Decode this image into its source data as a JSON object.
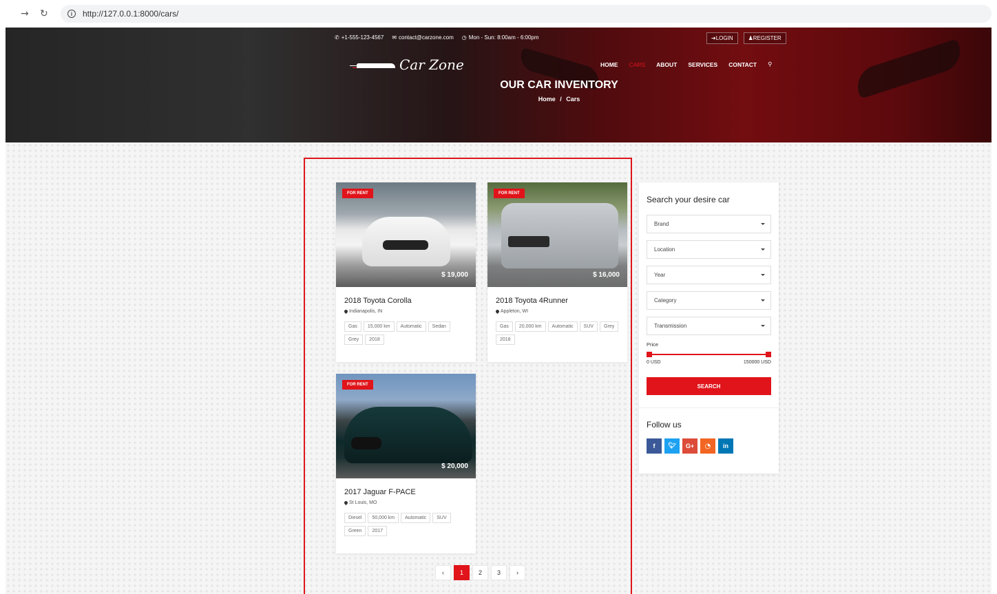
{
  "browser": {
    "url": "http://127.0.0.1:8000/cars/"
  },
  "topbar": {
    "phone": "+1-555-123-4567",
    "email": "contact@carzone.com",
    "hours": "Mon - Sun: 8:00am - 6:00pm",
    "login": "LOGIN",
    "register": "REGISTER"
  },
  "logo": {
    "text": "Car Zone"
  },
  "menu": {
    "home": "HOME",
    "cars": "CARS",
    "about": "ABOUT",
    "services": "SERVICES",
    "contact": "CONTACT"
  },
  "hero": {
    "title": "OUR CAR INVENTORY",
    "crumb_home": "Home",
    "crumb_sep": "/",
    "crumb_current": "Cars"
  },
  "cars": [
    {
      "tag": "FOR RENT",
      "price": "$ 19,000",
      "title": "2018 Toyota Corolla",
      "location": "Indianapolis, IN",
      "chips": [
        "Gas",
        "15,000 km",
        "Automatic",
        "Sedan",
        "Grey",
        "2018"
      ]
    },
    {
      "tag": "FOR RENT",
      "price": "$ 16,000",
      "title": "2018 Toyota 4Runner",
      "location": "Appleton, WI",
      "chips": [
        "Gas",
        "20,000 km",
        "Automatic",
        "SUV",
        "Grey",
        "2018"
      ]
    },
    {
      "tag": "FOR RENT",
      "price": "$ 20,000",
      "title": "2017 Jaguar F-PACE",
      "location": "St Louis, MO",
      "chips": [
        "Diesel",
        "50,000 km",
        "Automatic",
        "SUV",
        "Green",
        "2017"
      ]
    }
  ],
  "pagination": {
    "prev": "‹",
    "pages": [
      "1",
      "2",
      "3"
    ],
    "next": "›",
    "active": "1"
  },
  "search": {
    "title": "Search your desire car",
    "brand": "Brand",
    "location": "Location",
    "year": "Year",
    "category": "Category",
    "transmission": "Transmission",
    "price_label": "Price",
    "price_min": "0 USD",
    "price_max": "150000 USD",
    "button": "SEARCH"
  },
  "follow": {
    "title": "Follow us",
    "facebook": "f",
    "twitter": "t",
    "google": "G+",
    "rss": "rss",
    "linkedin": "in"
  },
  "colors": {
    "accent": "#e0141a",
    "facebook": "#3b5998",
    "twitter": "#1da1f2",
    "google": "#dd4b39",
    "rss": "#f26522",
    "linkedin": "#0077b5"
  }
}
